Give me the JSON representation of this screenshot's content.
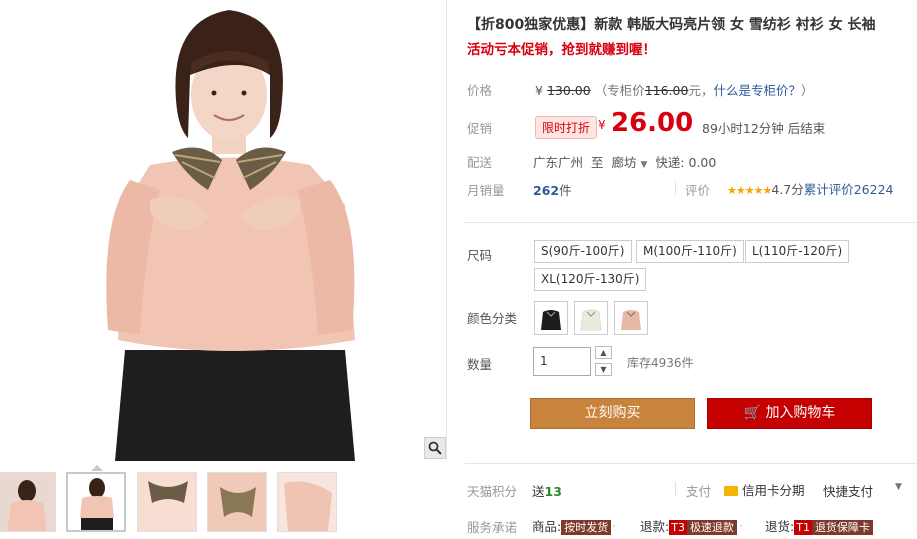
{
  "product": {
    "title": "【折800独家优惠】新款 韩版大码亮片领 女 雪纺衫 衬衫 女 长袖",
    "subtitle": "活动亏本促销，抢到就赚到喔！"
  },
  "price": {
    "label": "价格",
    "currency": "¥",
    "original": "130.00",
    "counter_text_pre": "（专柜价",
    "counter_value": "116.00",
    "counter_text_post": "元，",
    "counter_link": "什么是专柜价？",
    "close_paren": "）"
  },
  "promo": {
    "label": "促销",
    "tag": "限时打折",
    "currency": "¥",
    "price": "26.00",
    "countdown": "89小时12分钟 后结束"
  },
  "shipping": {
    "label": "配送",
    "from": "广东广州",
    "to_word": "至",
    "destination": "廊坊",
    "fee_label": "快递: 0.00"
  },
  "sales": {
    "label": "月销量",
    "count": "262",
    "unit": "件",
    "rating_label": "评价",
    "stars": "★★★★★",
    "score": "4.7分",
    "total_label": "累计评价",
    "total_count": "26224"
  },
  "sku": {
    "size_label": "尺码",
    "sizes": [
      "S(90斤-100斤)",
      "M(100斤-110斤)",
      "L(110斤-120斤)",
      "XL(120斤-130斤)"
    ],
    "color_label": "颜色分类",
    "colors": [
      "#1c1c1c",
      "#f2f0ea",
      "#e8b8a6"
    ],
    "qty_label": "数量",
    "qty_value": "1",
    "stock": "库存4936件"
  },
  "actions": {
    "buy_now": "立刻购买",
    "add_cart": "加入购物车"
  },
  "footer": {
    "points_label": "天猫积分",
    "points_text": "送",
    "points_value": "13",
    "pay_label": "支付",
    "credit": "信用卡分期",
    "quick_pay": "快捷支付",
    "service_label": "服务承诺",
    "svc1_pre": "商品:",
    "svc1_badge": "按时发货",
    "svc2_pre": "退款:",
    "svc2_t": "T3",
    "svc2_badge": "极速退款",
    "svc3_pre": "退货:",
    "svc3_t": "T1",
    "svc3_badge": "退货保障卡"
  }
}
